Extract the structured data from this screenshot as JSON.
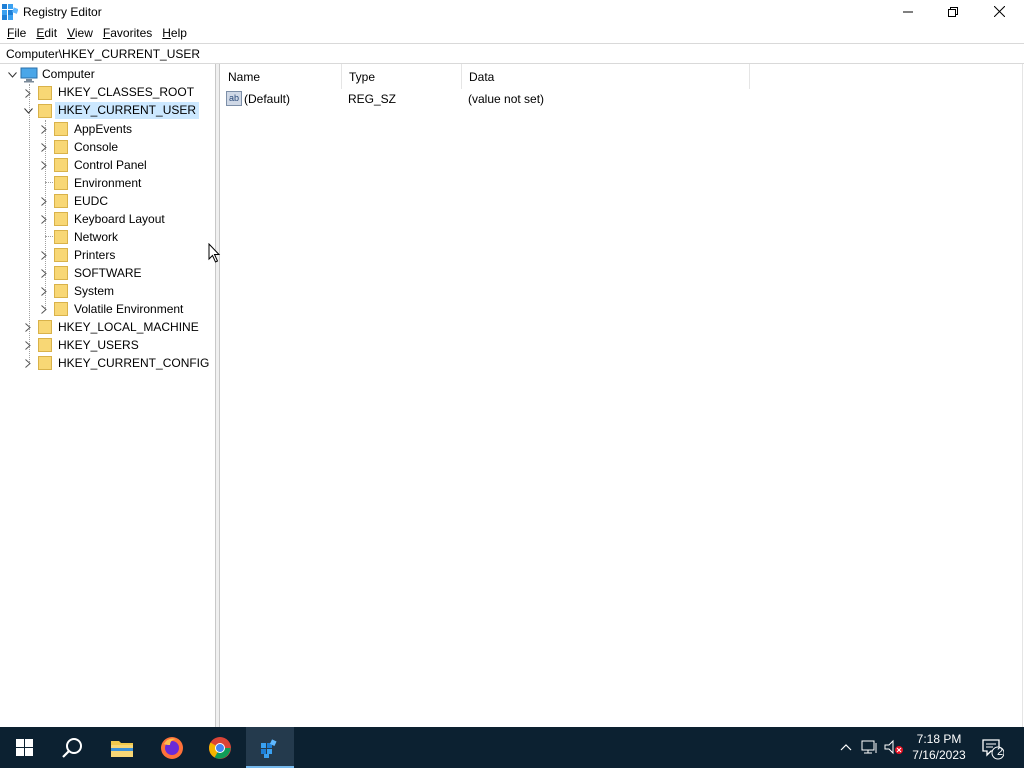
{
  "window": {
    "title": "Registry Editor",
    "minimize_glyph": "—",
    "restore_glyph": "❐",
    "close_glyph": "✕"
  },
  "menu": [
    {
      "label": "File",
      "accel": "F",
      "rest": "ile"
    },
    {
      "label": "Edit",
      "accel": "E",
      "rest": "dit"
    },
    {
      "label": "View",
      "accel": "V",
      "rest": "iew"
    },
    {
      "label": "Favorites",
      "accel": "F",
      "rest": "avorites"
    },
    {
      "label": "Help",
      "accel": "H",
      "rest": "elp"
    }
  ],
  "address": "Computer\\HKEY_CURRENT_USER",
  "tree": {
    "root": "Computer",
    "hives": [
      {
        "label": "HKEY_CLASSES_ROOT",
        "expanded": false
      },
      {
        "label": "HKEY_CURRENT_USER",
        "expanded": true,
        "selected": true
      },
      {
        "label": "HKEY_LOCAL_MACHINE",
        "expanded": false
      },
      {
        "label": "HKEY_USERS",
        "expanded": false
      },
      {
        "label": "HKEY_CURRENT_CONFIG",
        "expanded": false
      }
    ],
    "hkcu_children": [
      {
        "label": "AppEvents",
        "has_children": true
      },
      {
        "label": "Console",
        "has_children": true
      },
      {
        "label": "Control Panel",
        "has_children": true
      },
      {
        "label": "Environment",
        "has_children": false
      },
      {
        "label": "EUDC",
        "has_children": true
      },
      {
        "label": "Keyboard Layout",
        "has_children": true
      },
      {
        "label": "Network",
        "has_children": false
      },
      {
        "label": "Printers",
        "has_children": true
      },
      {
        "label": "SOFTWARE",
        "has_children": true
      },
      {
        "label": "System",
        "has_children": true
      },
      {
        "label": "Volatile Environment",
        "has_children": true
      }
    ]
  },
  "list": {
    "columns": [
      "Name",
      "Type",
      "Data"
    ],
    "rows": [
      {
        "name": "(Default)",
        "type": "REG_SZ",
        "data": "(value not set)",
        "icon": "string-value-icon",
        "icon_text": "ab"
      }
    ]
  },
  "taskbar": {
    "apps": [
      {
        "name": "start-button",
        "icon": "windows-logo-icon"
      },
      {
        "name": "search-button",
        "icon": "search-icon"
      },
      {
        "name": "file-explorer",
        "icon": "folder-icon"
      },
      {
        "name": "firefox",
        "icon": "firefox-icon"
      },
      {
        "name": "chrome",
        "icon": "chrome-icon"
      },
      {
        "name": "registry-editor",
        "icon": "registry-icon",
        "active": true
      }
    ],
    "tray_chevron": "^",
    "clock_time": "7:18 PM",
    "clock_date": "7/16/2023",
    "notification_count": "2"
  },
  "colors": {
    "taskbar_bg": "#0c2131",
    "selection": "#cce8ff",
    "folder": "#f8d775",
    "accent": "#76b9ed"
  }
}
